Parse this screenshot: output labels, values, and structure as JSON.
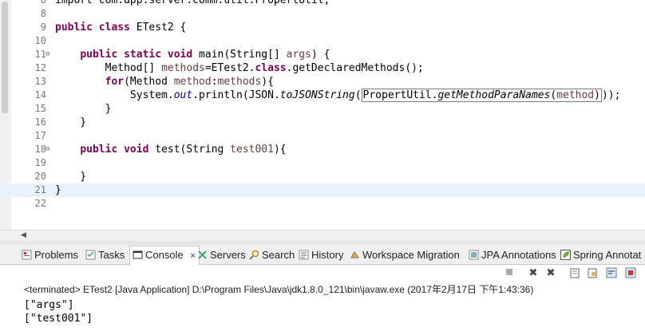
{
  "editor": {
    "lines": [
      {
        "n": "8",
        "segs": [
          {
            "t": "import com.app.server.comm.util.PropertUtil;"
          }
        ]
      },
      {
        "n": "8",
        "segs": []
      },
      {
        "n": "9",
        "segs": [
          {
            "t": "public",
            "c": "kw"
          },
          {
            "t": " "
          },
          {
            "t": "class",
            "c": "kw"
          },
          {
            "t": " ETest2 {"
          }
        ]
      },
      {
        "n": "10",
        "segs": []
      },
      {
        "n": "11",
        "fold": true,
        "segs": [
          {
            "t": "    "
          },
          {
            "t": "public",
            "c": "kw"
          },
          {
            "t": " "
          },
          {
            "t": "static",
            "c": "kw"
          },
          {
            "t": " "
          },
          {
            "t": "void",
            "c": "kw"
          },
          {
            "t": " main(String[] "
          },
          {
            "t": "args",
            "c": "var"
          },
          {
            "t": ") {"
          }
        ]
      },
      {
        "n": "12",
        "segs": [
          {
            "t": "        Method[] "
          },
          {
            "t": "methods",
            "c": "var"
          },
          {
            "t": "=ETest2."
          },
          {
            "t": "class",
            "c": "kw"
          },
          {
            "t": ".getDeclaredMethods();"
          }
        ]
      },
      {
        "n": "13",
        "segs": [
          {
            "t": "        "
          },
          {
            "t": "for",
            "c": "kw"
          },
          {
            "t": "(Method "
          },
          {
            "t": "method",
            "c": "var"
          },
          {
            "t": ":"
          },
          {
            "t": "methods",
            "c": "var"
          },
          {
            "t": "){"
          }
        ]
      },
      {
        "n": "14",
        "segs": [
          {
            "t": "            System."
          },
          {
            "t": "out",
            "c": "stat"
          },
          {
            "t": ".println(JSON."
          },
          {
            "t": "toJSONString",
            "c": "method-i"
          },
          {
            "t": "("
          },
          {
            "t": "PropertUtil.",
            "c": "box-start"
          },
          {
            "t": "getMethodParaNames",
            "c": "box-mid-i"
          },
          {
            "t": "(",
            "c": "box-mid"
          },
          {
            "t": "method",
            "c": "box-var"
          },
          {
            "t": ")",
            "c": "box-end"
          },
          {
            "t": "));"
          }
        ]
      },
      {
        "n": "15",
        "segs": [
          {
            "t": "        }"
          }
        ]
      },
      {
        "n": "16",
        "segs": [
          {
            "t": "    }"
          }
        ]
      },
      {
        "n": "17",
        "segs": []
      },
      {
        "n": "18",
        "fold": true,
        "segs": [
          {
            "t": "    "
          },
          {
            "t": "public",
            "c": "kw"
          },
          {
            "t": " "
          },
          {
            "t": "void",
            "c": "kw"
          },
          {
            "t": " test(String "
          },
          {
            "t": "test001",
            "c": "var"
          },
          {
            "t": "){"
          }
        ]
      },
      {
        "n": "19",
        "segs": []
      },
      {
        "n": "20",
        "segs": [
          {
            "t": "    }"
          }
        ]
      },
      {
        "n": "21",
        "current": true,
        "segs": [
          {
            "t": "}"
          }
        ]
      },
      {
        "n": "22",
        "segs": []
      }
    ]
  },
  "tabs": {
    "problems": "Problems",
    "tasks": "Tasks",
    "console": "Console",
    "console_close": "✕",
    "servers": "Servers",
    "search": "Search",
    "history": "History",
    "workspace_migration": "Workspace Migration",
    "jpa": "JPA Annotations",
    "spring": "Spring Annotat"
  },
  "console": {
    "title": "<terminated> ETest2 [Java Application] D:\\Program Files\\Java\\jdk1.8.0_121\\bin\\javaw.exe (2017年2月17日 下午1:43:36)",
    "output": [
      "[\"args\"]",
      "[\"test001\"]"
    ]
  },
  "colors": {
    "keyword": "#7f0055",
    "variable": "#6a3e3e",
    "static_field": "#0000c0",
    "current_line": "#e8f2fe"
  }
}
